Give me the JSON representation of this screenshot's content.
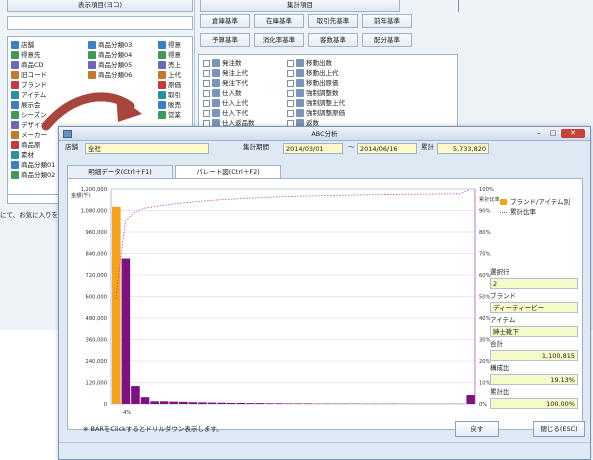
{
  "back_window": {
    "left_header": "表示項目(ヨコ)",
    "right_header": "集計項目",
    "tabs_row1": [
      "倉庫基準",
      "在庫基準",
      "取引先基準",
      "前年基準"
    ],
    "tabs_row2": [
      "予算基準",
      "消化率基準",
      "客数基準",
      "配分基準"
    ],
    "list_col1": [
      "店舗",
      "得意先",
      "商品CD",
      "旧コード",
      "ブランド",
      "アイテム",
      "展示会",
      "シーズン",
      "デザイナー",
      "メーカー",
      "商品原",
      "素材",
      "商品分類01",
      "商品分類02"
    ],
    "list_col2": [
      "商品分類03",
      "商品分類04",
      "商品分類05",
      "商品分類06",
      "",
      "",
      "",
      ""
    ],
    "list_col3": [
      "得意",
      "得意",
      "売上",
      "上代",
      "原価",
      "取引",
      "販売",
      "営業"
    ],
    "checks_col1": [
      "発注数",
      "発注上代",
      "発注下代",
      "仕入数",
      "仕入上代",
      "仕入下代",
      "仕入返品数"
    ],
    "checks_col2": [
      "移動出数",
      "移動出上代",
      "移動出原価",
      "強制調整数",
      "強制調整上代",
      "強制調整原価",
      "返数"
    ],
    "status_text": "にて、お気に入りを保"
  },
  "dialog": {
    "title": "ABC分析",
    "label_store": "店舗",
    "value_store": "全社",
    "label_period": "集計期間",
    "period_from": "2014/03/01",
    "period_sep": "〜",
    "period_to": "2014/06/16",
    "label_total": "累計",
    "value_total": "5,733,820",
    "tab_active": "明細データ(Ctrl＋F1)",
    "tab_inactive": "パレート図(Ctrl＋F2)",
    "legend": [
      "ブランド/アイテム別",
      "累計比率"
    ],
    "side": {
      "rank_label": "選択行",
      "rank_value": "2",
      "brand_label": "ブランド",
      "brand_value": "ディーティービー",
      "item_label": "アイテム",
      "item_value": "紳士靴下",
      "sum_label": "合計",
      "sum_value": "1,100,815",
      "ratio_label": "構成比",
      "ratio_value": "19.13%",
      "cumratio_label": "累計比",
      "cumratio_value": "100.00%"
    },
    "footer_note": "※ BARをClickするとドリルダウン表示します。",
    "back_button": "戻す",
    "close_button": "閉じる(ESC)"
  },
  "colors": {
    "accent_orange": "#f5a21b",
    "accent_purple": "#7b127f",
    "field_yellow": "#fff8c8",
    "frame_blue": "#9fb3cc"
  },
  "chart_data": {
    "type": "bar",
    "ylabel": "金額(千)",
    "y2label": "累計比率",
    "ylim": [
      0,
      1200000
    ],
    "y_ticks": [
      "1,200,000",
      "1,080,000",
      "960,000",
      "840,000",
      "720,000",
      "600,000",
      "480,000",
      "360,000",
      "240,000",
      "120,000",
      "0"
    ],
    "y2_ticks": [
      "100%",
      "90%",
      "80%",
      "70%",
      "60%",
      "50%",
      "40%",
      "30%",
      "20%",
      "10%",
      "0%"
    ],
    "x_tick_label": "4%",
    "values": [
      1100815,
      812000,
      100000,
      38000,
      15000,
      15000,
      13000,
      12000,
      10000,
      9000,
      8000,
      7000,
      6000,
      6000,
      5000,
      5000,
      4000,
      4000,
      3000,
      3000,
      3000,
      2000,
      2000,
      2000,
      2000,
      2000,
      1500,
      1500,
      1500,
      1500,
      1000,
      1000,
      1000,
      1000,
      1000,
      1000,
      1000,
      50000
    ],
    "highlight_index": 0
  }
}
